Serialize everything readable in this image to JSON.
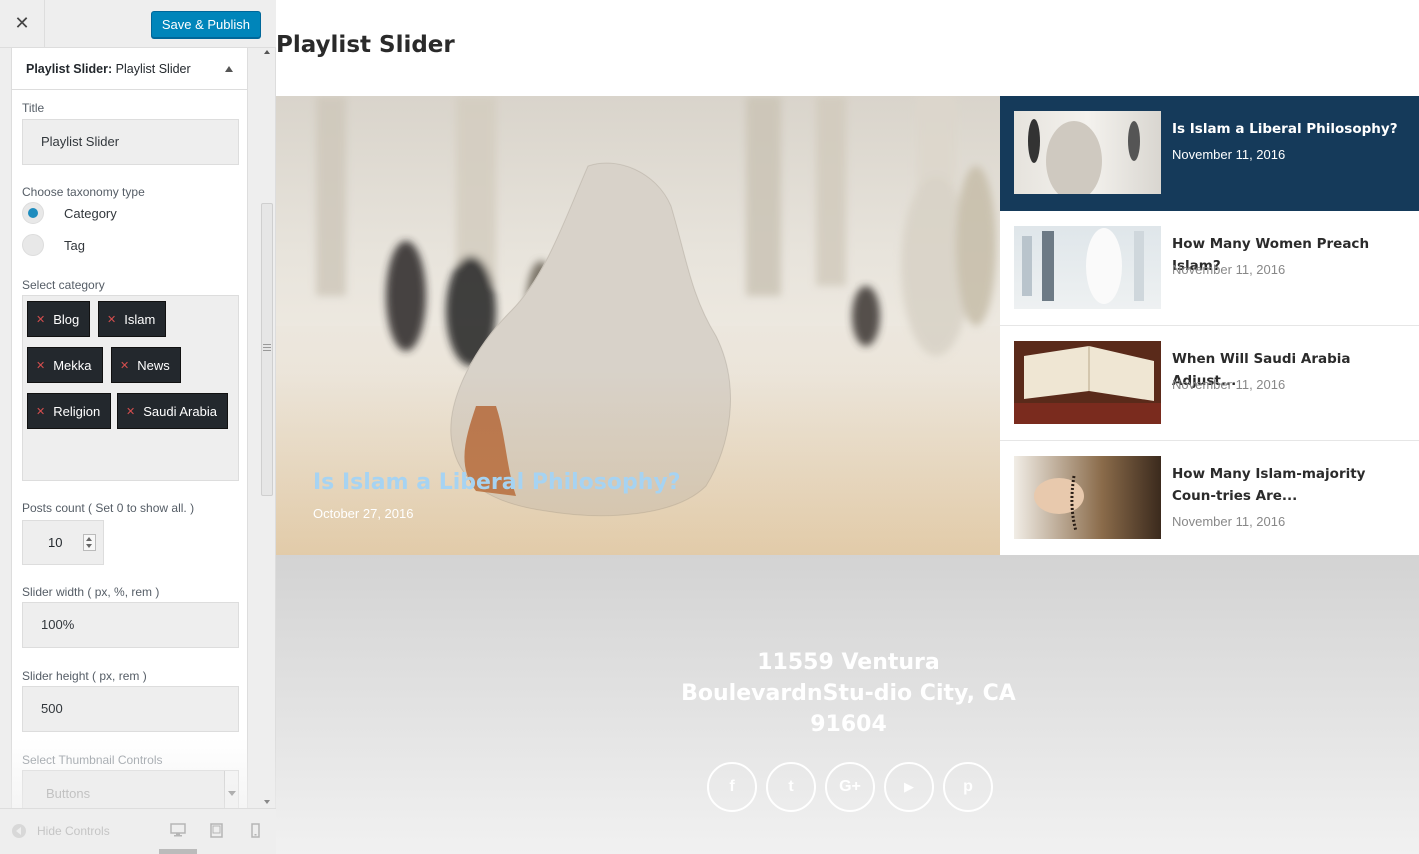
{
  "header": {
    "close_label": "✕",
    "publish_label": "Save & Publish"
  },
  "panel": {
    "title_prefix": "Playlist Slider:",
    "title_name": "Playlist Slider",
    "fields": {
      "title_label": "Title",
      "title_value": "Playlist Slider",
      "taxonomy_label": "Choose taxonomy type",
      "taxonomy_options": [
        "Category",
        "Tag"
      ],
      "taxonomy_selected": "Category",
      "category_label": "Select category",
      "categories": [
        "Blog",
        "Islam",
        "Mekka",
        "News",
        "Religion",
        "Saudi Arabia"
      ],
      "posts_count_label": "Posts count ( Set 0 to show all. )",
      "posts_count_value": "10",
      "slider_width_label": "Slider width ( px, %, rem )",
      "slider_width_value": "100%",
      "slider_height_label": "Slider height ( px, rem )",
      "slider_height_value": "500",
      "thumb_controls_label": "Select Thumbnail Controls",
      "thumb_controls_value": "Buttons"
    }
  },
  "footer_controls": {
    "hide_label": "Hide Controls"
  },
  "preview": {
    "widget_title": "Playlist Slider",
    "hero": {
      "title": "Is Islam a Liberal Philosophy?",
      "date": "October 27, 2016"
    },
    "playlist": [
      {
        "title": "Is Islam a Liberal Philosophy?",
        "date": "November 11, 2016"
      },
      {
        "title": "How Many Women Preach Islam?",
        "date": "November 11, 2016"
      },
      {
        "title": "When Will Saudi Arabia Adjust...",
        "date": "November 11, 2016"
      },
      {
        "title": "How Many Islam-majority Coun-tries Are...",
        "date": "November 11, 2016"
      }
    ],
    "address": "11559 Ventura BoulevardnStu-dio City, CA 91604",
    "social": [
      {
        "icon": "facebook-icon",
        "glyph": "f"
      },
      {
        "icon": "twitter-icon",
        "glyph": "t"
      },
      {
        "icon": "google-plus-icon",
        "glyph": "G+"
      },
      {
        "icon": "youtube-icon",
        "glyph": "▶"
      },
      {
        "icon": "pinterest-icon",
        "glyph": "p"
      }
    ]
  },
  "colors": {
    "accent": "#0085ba",
    "active_item": "#153a5a",
    "hero_title": "#a6d3f2",
    "tag_bg": "#23282d"
  }
}
